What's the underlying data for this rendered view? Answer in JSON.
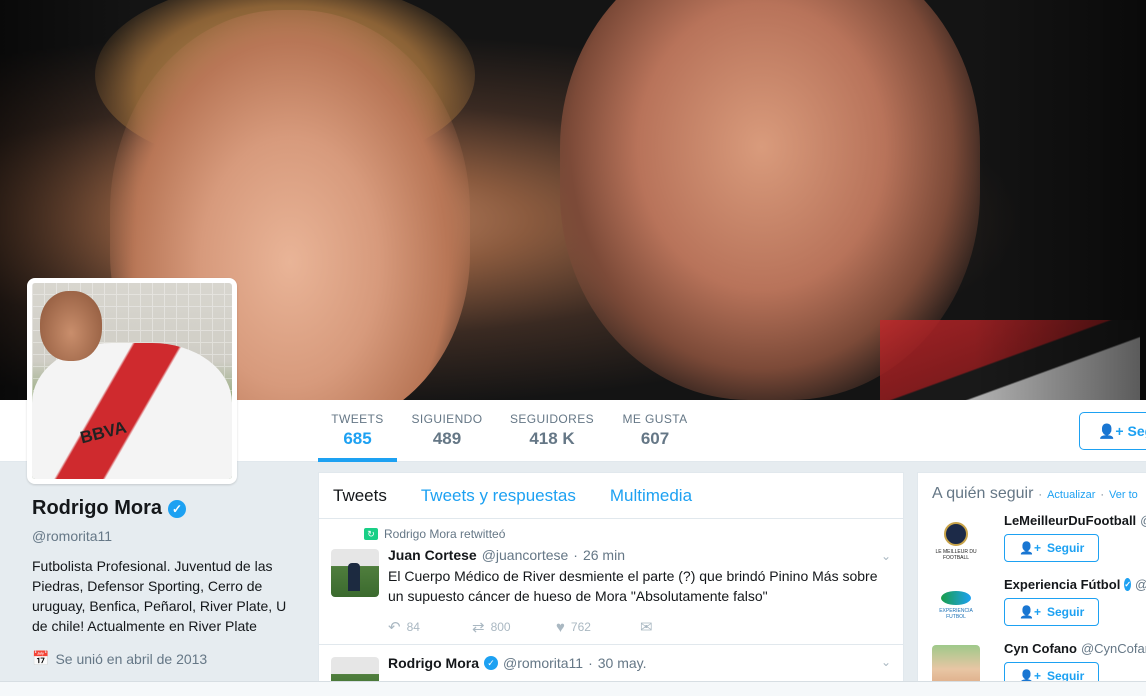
{
  "profile": {
    "name": "Rodrigo Mora",
    "handle": "@romorita11",
    "bio": "Futbolista Profesional. Juventud de las Piedras, Defensor Sporting, Cerro de uruguay, Benfica, Peñarol, River Plate, U de chile! Actualmente en River Plate",
    "joined": "Se unió en abril de 2013",
    "avatar_text": "BBVA"
  },
  "stats": [
    {
      "label": "TWEETS",
      "value": "685",
      "active": true
    },
    {
      "label": "SIGUIENDO",
      "value": "489"
    },
    {
      "label": "SEGUIDORES",
      "value": "418 K"
    },
    {
      "label": "ME GUSTA",
      "value": "607"
    }
  ],
  "follow_button": {
    "label": "Seg"
  },
  "timeline": {
    "tabs": [
      "Tweets",
      "Tweets y respuestas",
      "Multimedia"
    ],
    "tweets": [
      {
        "retweeted_by": "Rodrigo Mora retwitteó",
        "author": "Juan Cortese",
        "handle": "@juancortese",
        "sep": "·",
        "time": "26 min",
        "text": "El Cuerpo Médico de River desmiente el parte (?) que brindó Pinino Más sobre un supuesto cáncer de hueso de Mora \"Absolutamente falso\"",
        "replies": "84",
        "retweets": "800",
        "likes": "762"
      },
      {
        "author": "Rodrigo Mora",
        "handle": "@romorita11",
        "sep": "·",
        "time": "30 may."
      }
    ]
  },
  "who_to_follow": {
    "title": "A quién seguir",
    "refresh": "Actualizar",
    "sep": "·",
    "view_all": "Ver to",
    "follow_label": "Seguir",
    "accounts": [
      {
        "name": "LeMeilleurDuFootball",
        "handle": "@",
        "logo_text": "LE MEILLEUR DU FOOTBALL"
      },
      {
        "name": "Experiencia Fútbol",
        "handle": "@",
        "logo_text": "EXPERIENCIA FUTBOL",
        "verified": true
      },
      {
        "name": "Cyn Cofano",
        "handle": "@CynCofan"
      }
    ]
  },
  "colors": {
    "accent": "#1da1f2",
    "text": "#14171a",
    "muted": "#657786",
    "background": "#e6ecf0"
  }
}
